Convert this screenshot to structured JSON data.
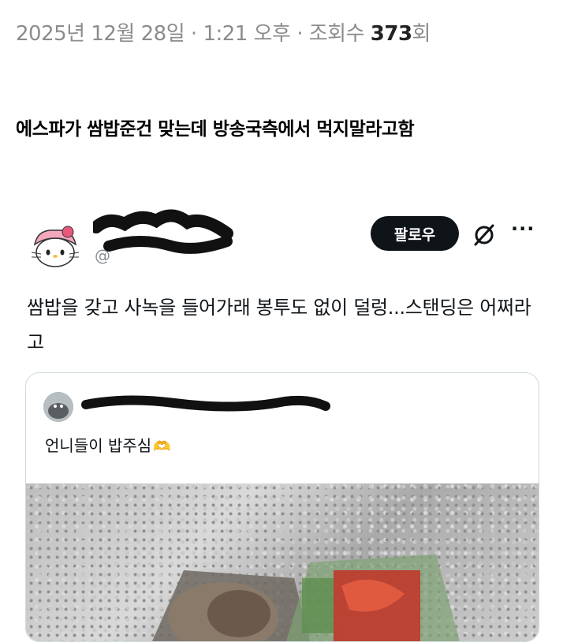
{
  "post": {
    "date": "2025년 12월 28일",
    "time": "1:21 오후",
    "views_label": "조회수",
    "views_count": "373",
    "views_suffix": "회",
    "separator": "·",
    "title": "에스파가 쌈밥준건 맞는데 방송국측에서 먹지말라고함"
  },
  "tweet": {
    "handle_prefix": "@",
    "follow_label": "팔로우",
    "more_label": "···",
    "text": "쌈밥을 갖고 사녹을 들어가래 봉투도 없이 덜렁...스탠딩은 어쩌라고",
    "quote": {
      "text": "언니들이 밥주심",
      "emoji": "🫶"
    }
  },
  "colors": {
    "follow_bg": "#0f1419",
    "meta_text": "#8c8c8c",
    "border": "#cfd9de"
  }
}
